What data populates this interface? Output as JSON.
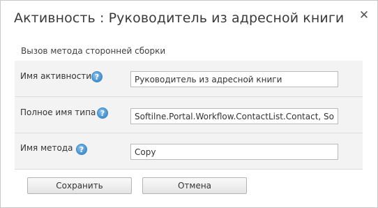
{
  "dialog": {
    "title": "Активность : Руководитель из адресной книги",
    "close_glyph": "✕"
  },
  "section": {
    "title": "Вызов метода сторонней сборки"
  },
  "fields": [
    {
      "label": "Имя активности",
      "value": "Руководитель из адресной книги"
    },
    {
      "label": "Полное имя типа",
      "value": "Softilne.Portal.Workflow.ContactList.Contact, Softi"
    },
    {
      "label": "Имя метода",
      "value": "Copy"
    }
  ],
  "help_glyph": "?",
  "buttons": {
    "save_label": "Сохранить",
    "cancel_label": "Отмена"
  }
}
